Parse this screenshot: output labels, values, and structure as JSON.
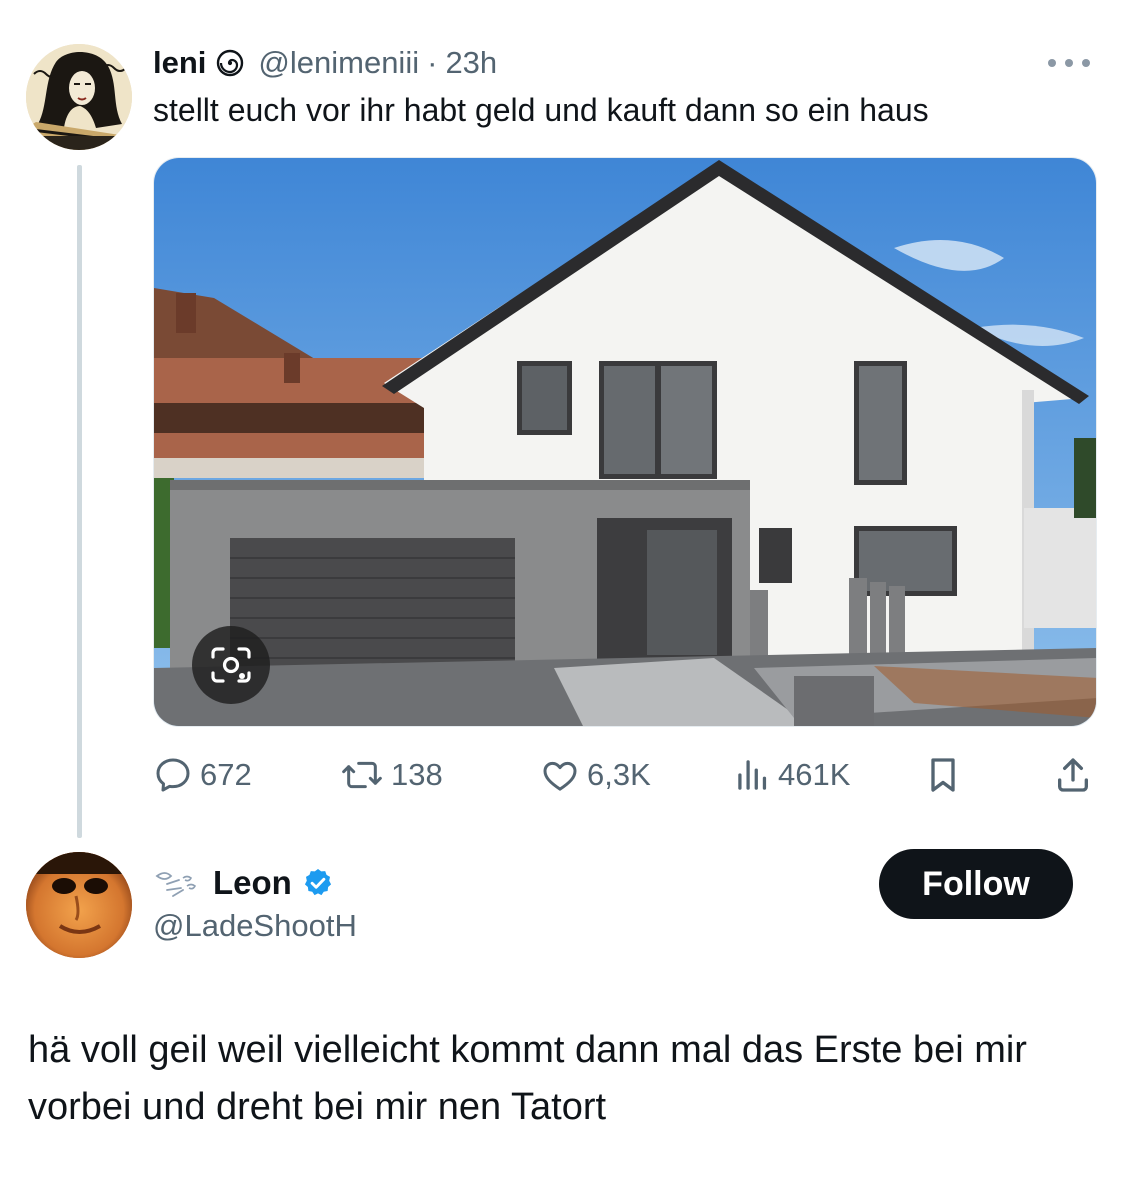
{
  "tweet": {
    "author_name": "leni",
    "author_handle": "@lenimeniii",
    "separator": "·",
    "time": "23h",
    "text": "stellt euch vor ihr habt geld und kauft dann so ein haus",
    "actions": {
      "replies": "672",
      "reposts": "138",
      "likes": "6,3K",
      "views": "461K"
    }
  },
  "reply": {
    "author_name": "Leon",
    "author_handle": "@LadeShootH",
    "verified": true,
    "follow_label": "Follow",
    "text": "hä voll geil weil vielleicht kommt dann mal das Erste bei mir vorbei und dreht bei mir nen Tatort"
  },
  "colors": {
    "text_primary": "#0f1419",
    "text_muted": "#536471",
    "thread_line": "#cfd9de",
    "verified_blue": "#1d9bf0",
    "follow_bg": "#0f1419"
  },
  "icons": {
    "more": "more-dots-icon",
    "reply": "reply-bubble-icon",
    "repost": "repost-arrows-icon",
    "like": "heart-icon",
    "views": "views-bar-icon",
    "bookmark": "bookmark-icon",
    "share": "share-upload-icon",
    "lens": "lens-search-icon",
    "verified": "verified-badge-icon"
  }
}
